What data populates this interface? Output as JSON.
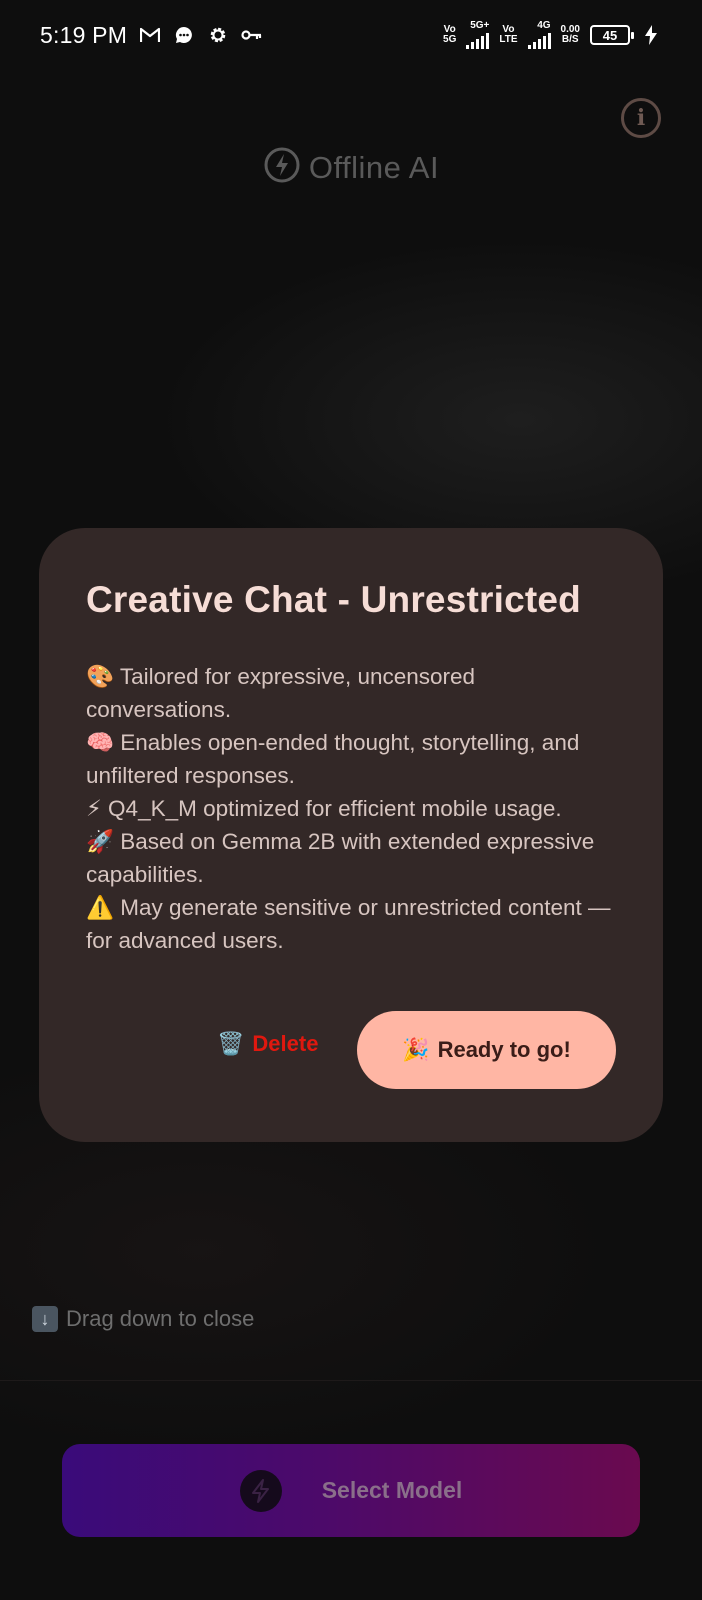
{
  "status_bar": {
    "time": "5:19 PM",
    "notification_icons": [
      "gmail-icon",
      "chat-bubble-icon",
      "settings-gear-icon",
      "key-icon"
    ],
    "net1_top": "Vo",
    "net1_bottom": "5G",
    "net2_label": "5G+",
    "net3_top": "Vo",
    "net3_bottom": "LTE",
    "net4_label": "4G",
    "speed_value": "0.00",
    "speed_unit": "B/S",
    "battery_level": "45"
  },
  "header": {
    "app_name": "Offline AI"
  },
  "dialog": {
    "title": "Creative Chat - Unrestricted",
    "lines": [
      "🎨 Tailored for expressive, uncensored conversations.",
      "🧠 Enables open-ended thought, storytelling, and unfiltered responses.",
      "⚡ Q4_K_M optimized for efficient mobile usage.",
      "🚀 Based on Gemma 2B with extended expressive capabilities.",
      "⚠️ May generate sensitive or unrestricted content — for advanced users."
    ],
    "delete_emoji": "🗑️",
    "delete_label": "Delete",
    "ready_emoji": "🎉",
    "ready_label": "Ready to go!"
  },
  "footer": {
    "drag_hint": "Drag down to close",
    "select_model_label": "Select Model"
  },
  "colors": {
    "dialog_bg": "#332827",
    "title": "#f6ddd6",
    "delete": "#e0180f",
    "ready_bg": "#ffb6a4",
    "gradient_start": "#3a0b7a",
    "gradient_end": "#6a0a4f"
  }
}
